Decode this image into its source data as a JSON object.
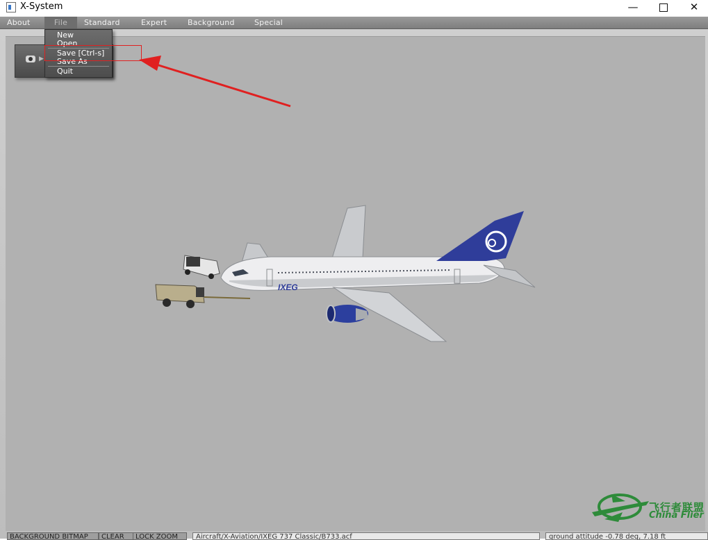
{
  "window": {
    "title": "X-System",
    "minimize_label": "—",
    "close_label": "✕"
  },
  "menu": {
    "items": [
      "About",
      "File",
      "Standard",
      "Expert",
      "Background",
      "Special"
    ],
    "active": "File"
  },
  "file_menu": {
    "items": [
      "New",
      "Open",
      "Save [Ctrl-s]",
      "Save As",
      "Quit"
    ]
  },
  "aircraft": {
    "livery_text": "IXEG"
  },
  "status_bar": {
    "background_bitmap": "BACKGROUND BITMAP",
    "clear": "CLEAR",
    "lock_zoom": "LOCK ZOOM",
    "path": "Aircraft/X-Aviation/IXEG 737 Classic/B733.acf",
    "attitude": "ground attitude -0.78 deg, 7.18 ft"
  },
  "watermark": {
    "chinese": "飞行者联盟",
    "english": "China Flier"
  },
  "colors": {
    "annotation": "#e02020",
    "tail": "#2f3d9a",
    "watermark": "#2e8b3a"
  }
}
